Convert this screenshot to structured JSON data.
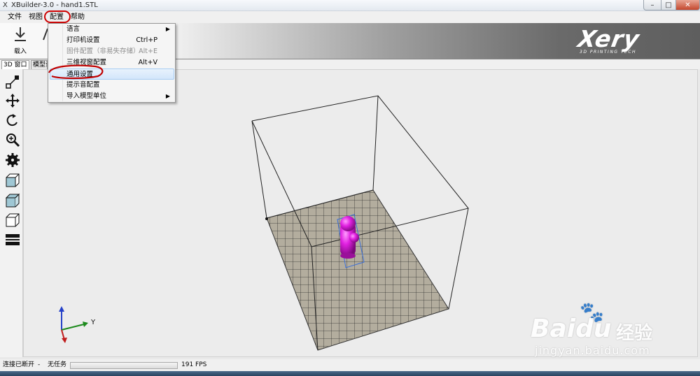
{
  "window": {
    "app_icon": "X",
    "title": "XBuilder-3.0 - hand1.STL",
    "minimize_glyph": "–",
    "maximize_glyph": "□",
    "close_glyph": "✕"
  },
  "menubar": {
    "items": [
      "文件",
      "视图",
      "配置",
      "帮助"
    ],
    "active_index": 2
  },
  "toolbar": {
    "load_label": "载入",
    "load_icon": "download-arrow-icon"
  },
  "logo": {
    "word": "Xery",
    "tagline": "3D PRINTING TECH"
  },
  "tabs": [
    "3D 窗口",
    "模型设"
  ],
  "dropdown": {
    "items": [
      {
        "label": "语言",
        "shortcut": "",
        "submenu": true,
        "disabled": false,
        "highlighted": false
      },
      {
        "label": "打印机设置",
        "shortcut": "Ctrl+P",
        "submenu": false,
        "disabled": false,
        "highlighted": false
      },
      {
        "label": "固件配置（非易失存储）",
        "shortcut": "Alt+E",
        "submenu": false,
        "disabled": true,
        "highlighted": false
      },
      {
        "label": "三维视窗配置",
        "shortcut": "Alt+V",
        "submenu": false,
        "disabled": false,
        "highlighted": false
      },
      {
        "label": "通用设置",
        "shortcut": "",
        "submenu": false,
        "disabled": false,
        "highlighted": true
      },
      {
        "label": "提示音配置",
        "shortcut": "",
        "submenu": false,
        "disabled": false,
        "highlighted": false
      },
      {
        "label": "导入模型单位",
        "shortcut": "",
        "submenu": true,
        "disabled": false,
        "highlighted": false
      }
    ]
  },
  "left_tools": [
    "resize-icon",
    "move-icon",
    "rotate-icon",
    "zoom-icon",
    "gear-icon",
    "cube-view-front-icon",
    "cube-view-top-icon",
    "cube-view-side-icon",
    "layers-icon"
  ],
  "axis_labels": {
    "y": "Y"
  },
  "statusbar": {
    "connection": "连接已断开",
    "separator": "-",
    "task": "无任务",
    "fps": "191 FPS"
  },
  "watermark": {
    "brand": "Bai",
    "paw": "🐾",
    "brand_du": "du",
    "cn": "经验",
    "url": "jingyan.baidu.com"
  },
  "colors": {
    "highlight_circle": "#c00000",
    "model": "#e020e0",
    "grid_fill": "#b3ad9e"
  }
}
